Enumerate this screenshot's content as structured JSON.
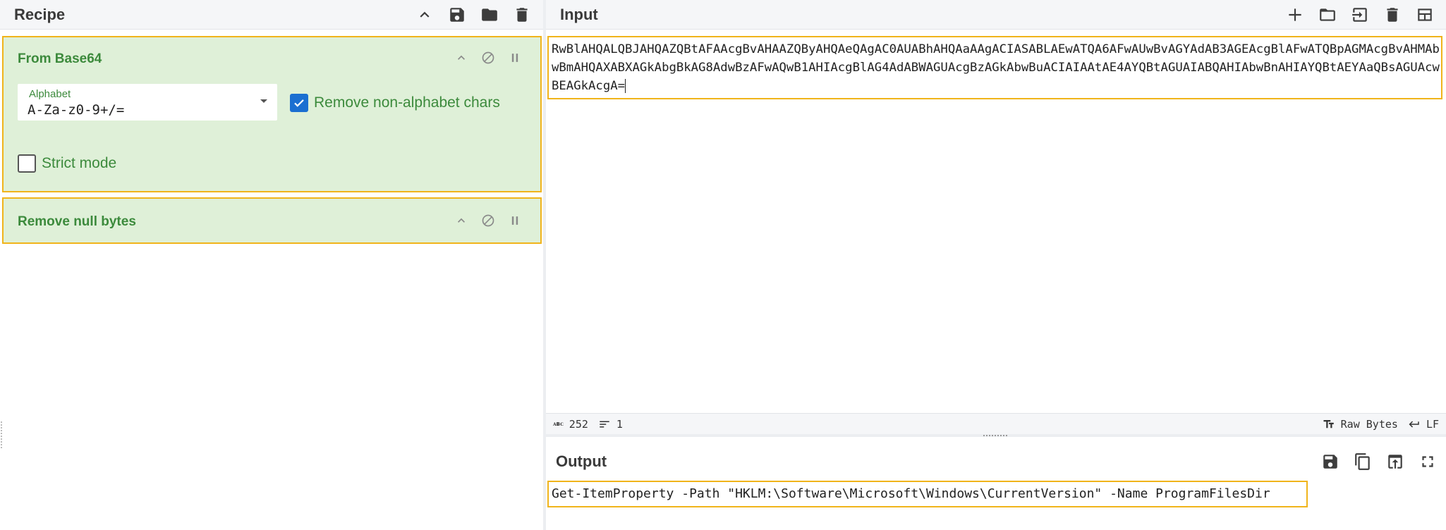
{
  "recipe": {
    "title": "Recipe",
    "operations": [
      {
        "name": "From Base64",
        "alphabet_label": "Alphabet",
        "alphabet_value": "A-Za-z0-9+/=",
        "remove_non_alphabet_label": "Remove non-alphabet chars",
        "remove_non_alphabet_checked": true,
        "strict_mode_label": "Strict mode",
        "strict_mode_checked": false
      },
      {
        "name": "Remove null bytes"
      }
    ]
  },
  "input": {
    "title": "Input",
    "text": "RwBlAHQALQBJAHQAZQBtAFAAcgBvAHAAZQByAHQAeQAgAC0AUABhAHQAaAAgACIASABLAEwATQA6AFwAUwBvAGYAdAB3AGEAcgBlAFwATQBpAGMAcgBvAHMAbwBmAHQAXABXAGkAbgBkAG8AdwBzAFwAQwB1AHIAcgBlAG4AdABWAGUAcgBzAGkAbwBuACIAIAAtAE4AYQBtAGUAIABQAHIAbwBnAHIAYQBtAEYAaQBsAGUAcwBEAGkAcgA="
  },
  "status": {
    "abc_icon": "ᴀʙᴄ",
    "char_count": "252",
    "line_count": "1",
    "raw_bytes_label": "Raw Bytes",
    "eol_label": "LF"
  },
  "output": {
    "title": "Output",
    "text": "Get-ItemProperty -Path \"HKLM:\\Software\\Microsoft\\Windows\\CurrentVersion\" -Name ProgramFilesDir"
  },
  "colors": {
    "operation_bg": "#dff0d8",
    "operation_border": "#f0b41b",
    "operation_text": "#3c8a3c",
    "checkbox_on": "#1b6fd1"
  }
}
